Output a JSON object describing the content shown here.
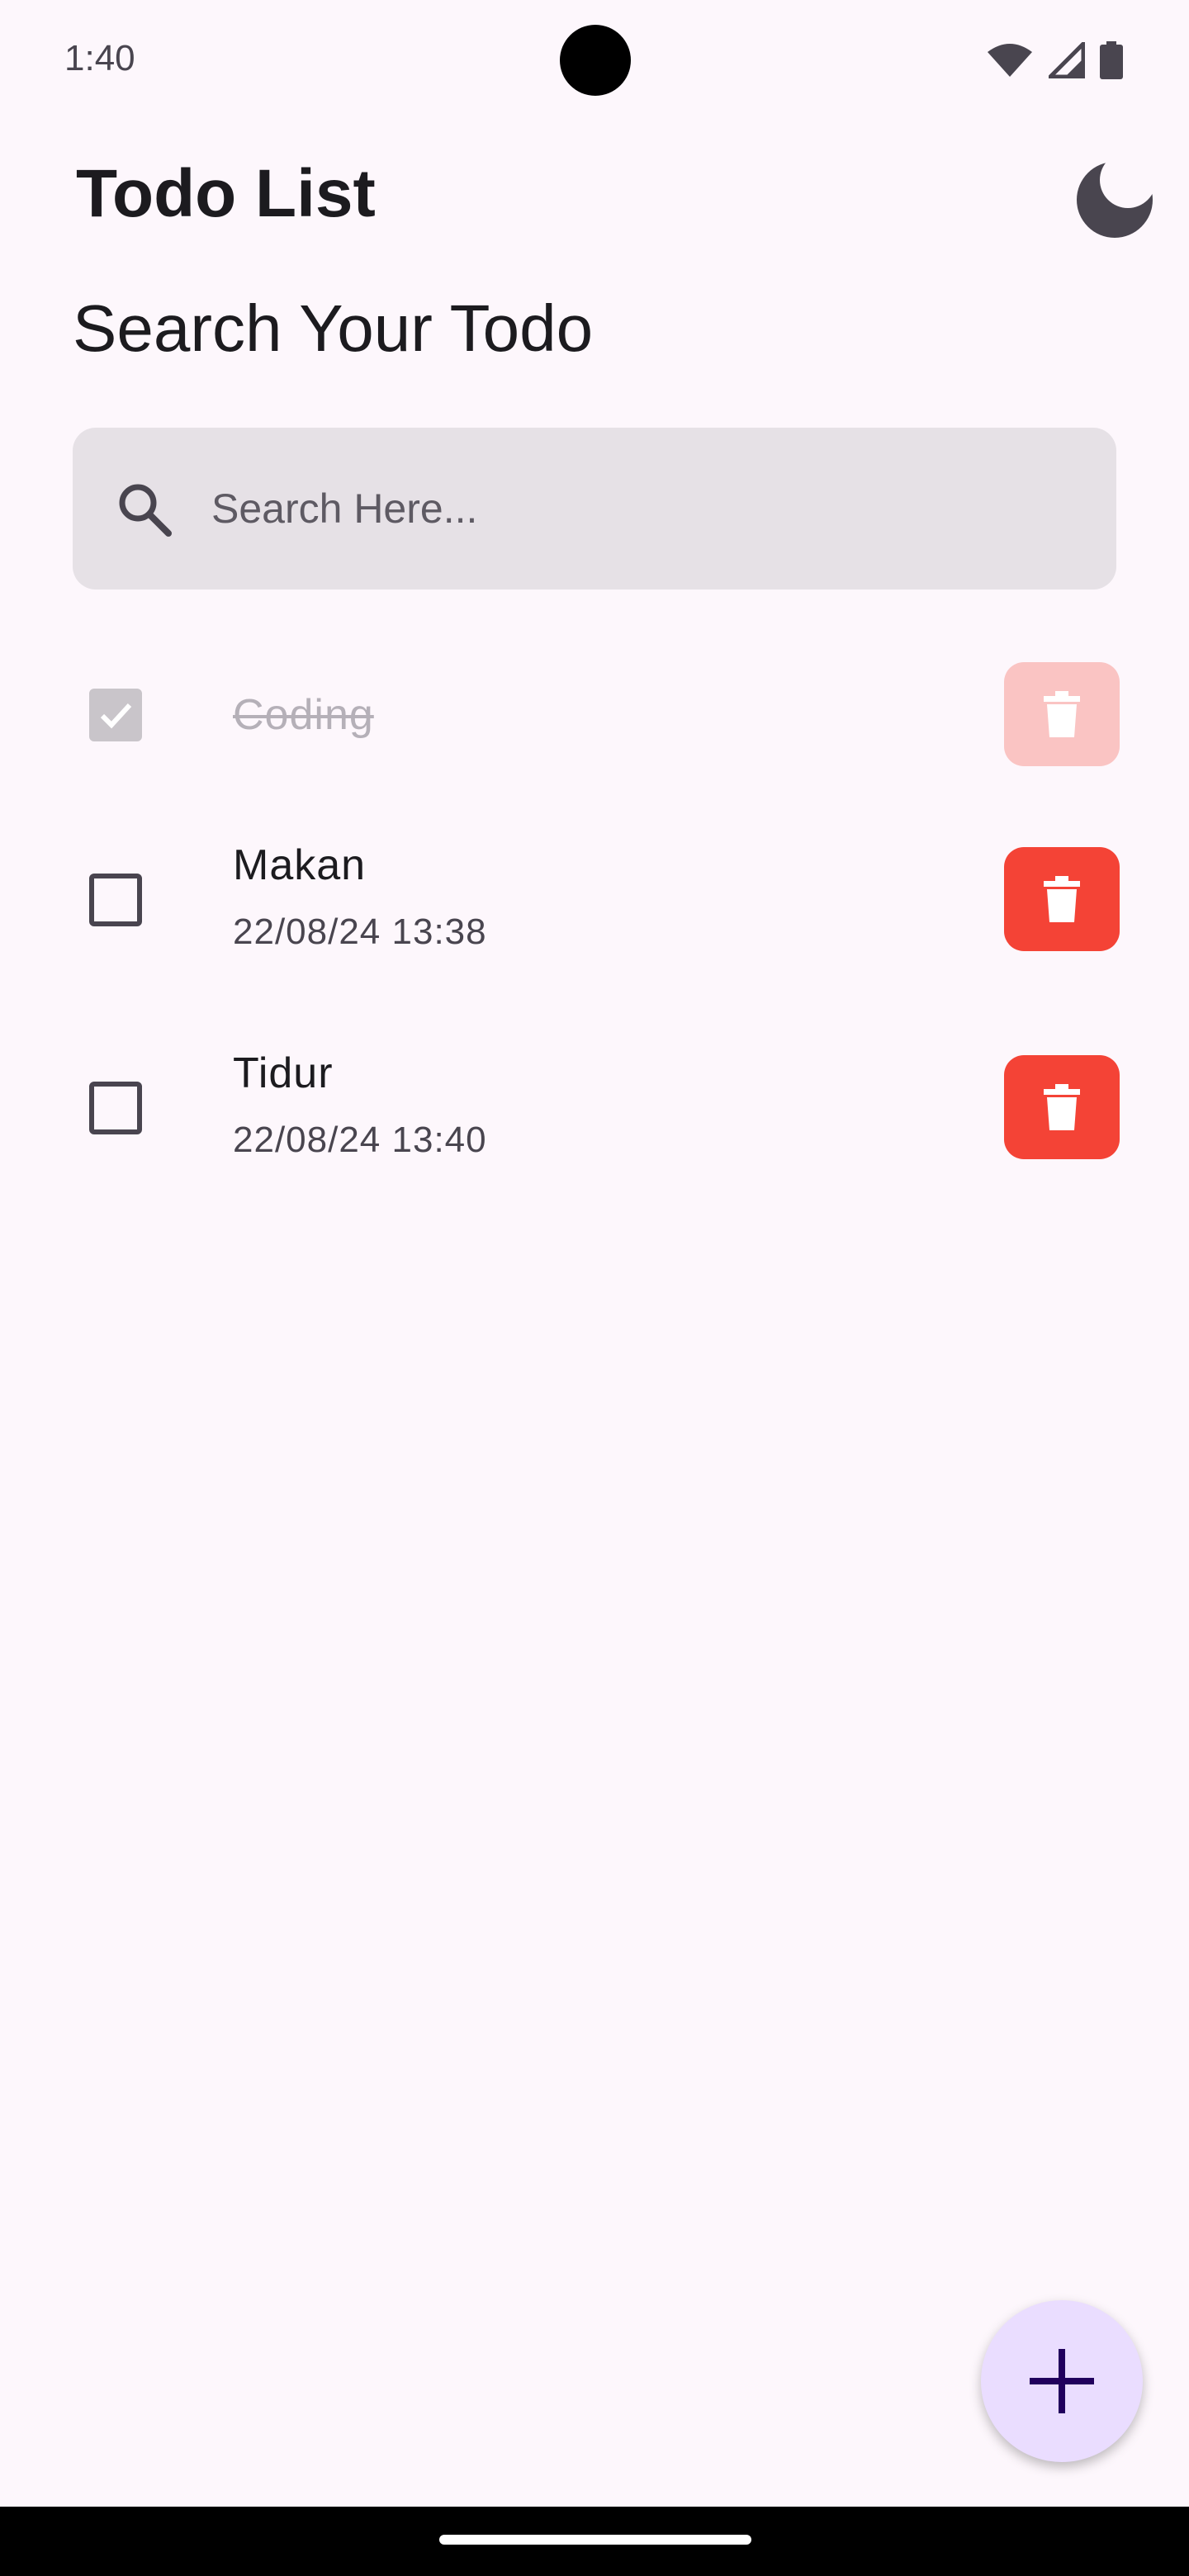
{
  "status_bar": {
    "time": "1:40",
    "icons": [
      "wifi-icon",
      "signal-icon",
      "battery-icon"
    ]
  },
  "header": {
    "title": "Todo List",
    "theme_toggle_icon": "moon-icon"
  },
  "search": {
    "heading": "Search Your Todo",
    "placeholder": "Search Here...",
    "value": "",
    "icon": "search-icon"
  },
  "todos": [
    {
      "title": "Coding",
      "date": "",
      "completed": true
    },
    {
      "title": "Makan",
      "date": "22/08/24 13:38",
      "completed": false
    },
    {
      "title": "Tidur",
      "date": "22/08/24 13:40",
      "completed": false
    }
  ],
  "fab": {
    "icon": "plus-icon"
  },
  "colors": {
    "background": "#FDF7FC",
    "delete": "#F44336",
    "delete_disabled": "#FAC4C3",
    "fab": "#EADDFF",
    "search_fill": "#E6E1E6"
  }
}
